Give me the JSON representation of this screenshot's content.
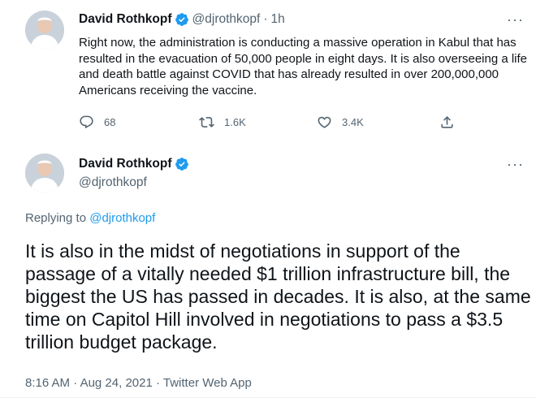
{
  "tweet1": {
    "name": "David Rothkopf",
    "handle": "@djrothkopf",
    "separator": "·",
    "time": "1h",
    "more": "···",
    "text": "Right now, the administration is conducting a massive operation in Kabul that has resulted in the evacuation of 50,000 people in eight days.  It is also overseeing a life and death battle against COVID that has already resulted in over 200,000,000 Americans receiving the vaccine.",
    "replies": "68",
    "retweets": "1.6K",
    "likes": "3.4K",
    "icons": [
      "reply-icon",
      "retweet-icon",
      "like-icon",
      "share-icon"
    ]
  },
  "tweet2": {
    "name": "David Rothkopf",
    "handle": "@djrothkopf",
    "more": "···",
    "replying_prefix": "Replying to ",
    "replying_to": "@djrothkopf",
    "text": "It is also in the midst of negotiations in support of the passage of a vitally needed $1 trillion infrastructure bill, the biggest the US has passed in decades.  It is also, at the same time on Capitol Hill involved in negotiations to pass a $3.5 trillion budget package.",
    "time": "8:16 AM",
    "date": "Aug 24, 2021",
    "source": "Twitter Web App",
    "separator": "·"
  },
  "colors": {
    "accent": "#1d9bf0",
    "secondary_text": "#536471",
    "primary_text": "#0f1419"
  }
}
